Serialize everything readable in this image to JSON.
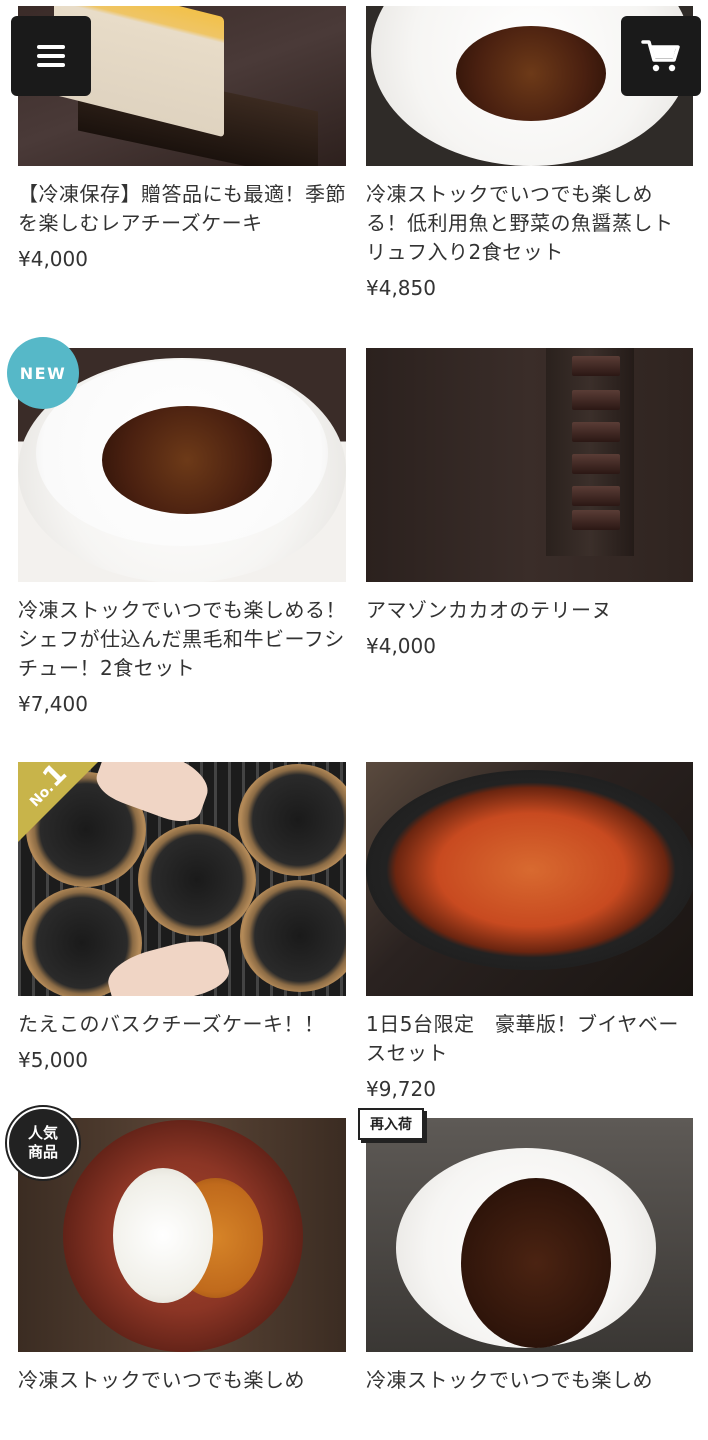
{
  "header": {
    "menu_icon": "hamburger-menu-icon",
    "cart_icon": "shopping-cart-icon"
  },
  "products": [
    {
      "title": "【冷凍保存】贈答品にも最適！季節を楽しむレアチーズケーキ",
      "price": "¥4,000",
      "badge": ""
    },
    {
      "title": "冷凍ストックでいつでも楽しめる！低利用魚と野菜の魚醤蒸しトリュフ入り2食セット",
      "price": "¥4,850",
      "badge": ""
    },
    {
      "title": "冷凍ストックでいつでも楽しめる！シェフが仕込んだ黒毛和牛ビーフシチュー！2食セット",
      "price": "¥7,400",
      "badge": "NEW"
    },
    {
      "title": "アマゾンカカオのテリーヌ",
      "price": "¥4,000",
      "badge": ""
    },
    {
      "title": "たえこのバスクチーズケーキ！！",
      "price": "¥5,000",
      "badge_no": "No.",
      "badge_num": "1"
    },
    {
      "title": "1日5台限定　豪華版！ブイヤベースセット",
      "price": "¥9,720",
      "badge": ""
    },
    {
      "title": "冷凍ストックでいつでも楽しめ",
      "price": "",
      "badge_line1": "人気",
      "badge_line2": "商品"
    },
    {
      "title": "冷凍ストックでいつでも楽しめ",
      "price": "",
      "badge": "再入荷"
    }
  ],
  "colors": {
    "badge_new": "#56b8c8",
    "badge_no1": "#c8b44a",
    "header_button": "#1a1a1a"
  }
}
